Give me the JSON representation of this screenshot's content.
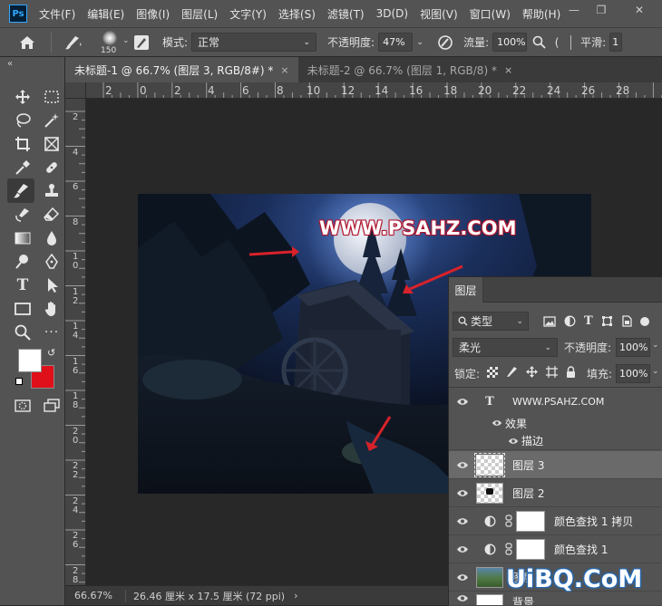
{
  "app": {
    "logo": "Ps"
  },
  "menu": {
    "items": [
      "文件(F)",
      "编辑(E)",
      "图像(I)",
      "图层(L)",
      "文字(Y)",
      "选择(S)",
      "滤镜(T)",
      "3D(D)",
      "视图(V)",
      "窗口(W)",
      "帮助(H)"
    ]
  },
  "window_controls": {
    "minimize": "—",
    "restore": "❐",
    "close": "✕"
  },
  "options": {
    "brush_size": "150",
    "mode_label": "模式:",
    "mode_value": "正常",
    "opacity_label": "不透明度:",
    "opacity_value": "47%",
    "flow_label": "流量:",
    "flow_value": "100%",
    "smooth_label": "平滑:",
    "smooth_value": "1"
  },
  "tabs": [
    {
      "label": "未标题-1 @ 66.7% (图层 3, RGB/8#) *",
      "close": "×"
    },
    {
      "label": "未标题-2 @ 66.7% (图层 1, RGB/8) *",
      "close": "×"
    }
  ],
  "ruler_top": [
    "2",
    "0",
    "2",
    "4",
    "6",
    "8",
    "10",
    "12",
    "14",
    "16",
    "18",
    "20",
    "22",
    "24",
    "26",
    "28"
  ],
  "ruler_left": [
    "2",
    "4",
    "6",
    "8",
    "1\n0",
    "1\n2",
    "1\n4",
    "1\n6",
    "1\n8",
    "2\n0",
    "2\n2",
    "2\n4",
    "2\n6",
    "2\n8",
    "3\n0",
    "3\n2",
    "3\n4",
    "3\n6",
    "3\n8"
  ],
  "canvas": {
    "watermark": "WWW.PSAHZ.COM"
  },
  "status": {
    "zoom": "66.67%",
    "doc_info": "26.46 厘米 x 17.5 厘米 (72 ppi)",
    "arrow": "›"
  },
  "layers_panel": {
    "tab": "图层",
    "filter_kind": "类型",
    "blend_mode": "柔光",
    "opacity_label": "不透明度:",
    "opacity_value": "100%",
    "lock_label": "锁定:",
    "fill_label": "填充:",
    "fill_value": "100%",
    "text_layer": "WWW.PSAHZ.COM",
    "effects_label": "效果",
    "stroke_label": "描边",
    "layers": [
      {
        "name": "图层 3",
        "selected": true
      },
      {
        "name": "图层 2",
        "selected": false
      },
      {
        "name": "颜色查找 1 拷贝",
        "selected": false
      },
      {
        "name": "颜色查找 1",
        "selected": false
      },
      {
        "name": "图层",
        "selected": false
      },
      {
        "name": "背景",
        "selected": false
      }
    ]
  },
  "site_watermark": "UiBQ.CoM",
  "colors": {
    "foreground": "#ffffff",
    "background": "#e0101a",
    "accent": "#31a8ff"
  }
}
